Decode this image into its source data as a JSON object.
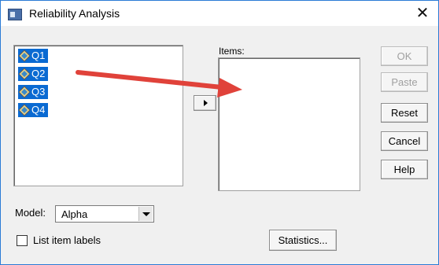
{
  "window": {
    "title": "Reliability Analysis",
    "close_glyph": "✕",
    "app_icon": "spss-dialog-icon"
  },
  "source_list": {
    "items": [
      {
        "label": "Q1",
        "icon": "scale-variable-icon"
      },
      {
        "label": "Q2",
        "icon": "scale-variable-icon"
      },
      {
        "label": "Q3",
        "icon": "scale-variable-icon"
      },
      {
        "label": "Q4",
        "icon": "scale-variable-icon"
      }
    ],
    "selected_color": "#0a6ad2"
  },
  "items_list": {
    "label": "Items:",
    "items": []
  },
  "buttons": {
    "ok": "OK",
    "paste": "Paste",
    "reset": "Reset",
    "cancel": "Cancel",
    "help": "Help",
    "statistics": "Statistics..."
  },
  "model": {
    "label": "Model:",
    "selected": "Alpha"
  },
  "list_item_labels": {
    "label": "List item labels",
    "checked": false
  },
  "annotation": {
    "type": "arrow",
    "color": "#e0423a"
  }
}
